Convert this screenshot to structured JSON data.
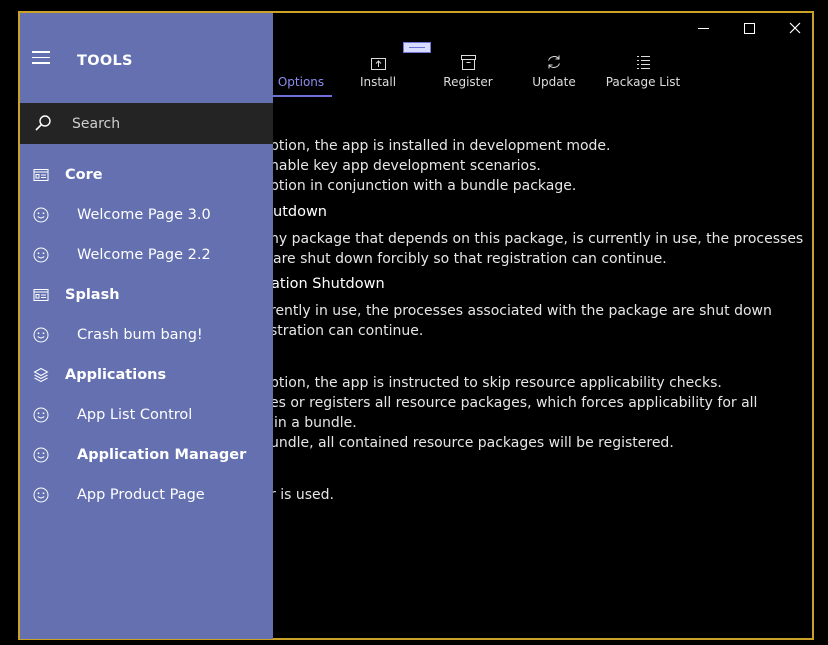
{
  "window": {
    "caption": {
      "minimize": "—",
      "maximize": "☐",
      "close": "✕"
    }
  },
  "toolbar": {
    "options": "Options",
    "install": "Install",
    "register": "Register",
    "update": "Update",
    "package_list": "Package List"
  },
  "content": {
    "lines": [
      "ption, the app is installed in development mode.",
      "nable key app development scenarios.",
      "ption in conjunction with a bundle package.",
      "utdown",
      "ny package that depends on this package, is currently in use, the processes",
      "are shut down forcibly so that registration can continue.",
      "ation Shutdown",
      "rently in use, the processes associated with the package are shut down",
      "stration can continue.",
      "ption, the app is instructed to skip resource applicability checks.",
      "es or registers all resource packages, which forces applicability for all",
      "in a bundle.",
      "undle, all contained resource packages will be registered.",
      "r is used."
    ]
  },
  "nav": {
    "title": "TOOLS",
    "search_placeholder": "Search",
    "items": [
      {
        "label": "Core",
        "icon": "page-icon"
      },
      {
        "label": "Welcome Page 3.0",
        "icon": "smiley-icon"
      },
      {
        "label": "Welcome Page 2.2",
        "icon": "smiley-icon"
      },
      {
        "label": "Splash",
        "icon": "page-icon"
      },
      {
        "label": "Crash bum bang!",
        "icon": "smiley-icon"
      },
      {
        "label": "Applications",
        "icon": "stack-icon"
      },
      {
        "label": "App List Control",
        "icon": "smiley-icon"
      },
      {
        "label": "Application Manager",
        "icon": "smiley-icon"
      },
      {
        "label": "App Product Page",
        "icon": "smiley-icon"
      }
    ]
  },
  "colors": {
    "nav_bg": "#6470b0",
    "accent": "#8b8ef0",
    "window_border": "#c9a227",
    "search_bg": "#242424"
  }
}
